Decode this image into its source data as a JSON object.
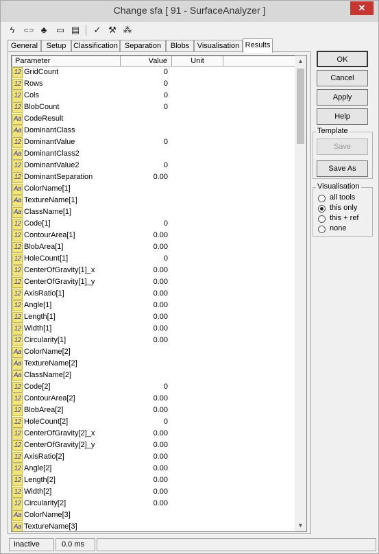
{
  "window": {
    "title": "Change sfa [ 91 - SurfaceAnalyzer ]",
    "close_glyph": "✕"
  },
  "toolbar": [
    {
      "icon": "lightning-icon",
      "glyph": "ϟ"
    },
    {
      "icon": "link-icon",
      "glyph": "⊂⊃"
    },
    {
      "icon": "tree-icon",
      "glyph": "♣"
    },
    {
      "icon": "console-icon",
      "glyph": "▭"
    },
    {
      "icon": "document-icon",
      "glyph": "▤"
    },
    {
      "icon": "check-icon",
      "glyph": "✓"
    },
    {
      "icon": "wrench-icon",
      "glyph": "⚒"
    },
    {
      "icon": "tree-structure-icon",
      "glyph": "⁂"
    }
  ],
  "tabs": [
    "General",
    "Setup",
    "Classification",
    "Separation",
    "Blobs",
    "Visualisation",
    "Results"
  ],
  "active_tab": "Results",
  "table": {
    "headers": [
      "Parameter",
      "Value",
      "Unit"
    ],
    "rows": [
      {
        "type": "12",
        "name": "GridCount",
        "value": "0"
      },
      {
        "type": "12",
        "name": "Rows",
        "value": "0"
      },
      {
        "type": "12",
        "name": "Cols",
        "value": "0"
      },
      {
        "type": "12",
        "name": "BlobCount",
        "value": "0"
      },
      {
        "type": "Aa",
        "name": "CodeResult",
        "value": ""
      },
      {
        "type": "Aa",
        "name": "DominantClass",
        "value": ""
      },
      {
        "type": "12",
        "name": "DominantValue",
        "value": "0"
      },
      {
        "type": "Aa",
        "name": "DominantClass2",
        "value": ""
      },
      {
        "type": "12",
        "name": "DominantValue2",
        "value": "0"
      },
      {
        "type": "12",
        "name": "DominantSeparation",
        "value": "0.00"
      },
      {
        "type": "Aa",
        "name": "ColorName[1]",
        "value": ""
      },
      {
        "type": "Aa",
        "name": "TextureName[1]",
        "value": ""
      },
      {
        "type": "Aa",
        "name": "ClassName[1]",
        "value": ""
      },
      {
        "type": "12",
        "name": "Code[1]",
        "value": "0"
      },
      {
        "type": "12",
        "name": "ContourArea[1]",
        "value": "0.00"
      },
      {
        "type": "12",
        "name": "BlobArea[1]",
        "value": "0.00"
      },
      {
        "type": "12",
        "name": "HoleCount[1]",
        "value": "0"
      },
      {
        "type": "12",
        "name": "CenterOfGravity[1]_x",
        "value": "0.00"
      },
      {
        "type": "12",
        "name": "CenterOfGravity[1]_y",
        "value": "0.00"
      },
      {
        "type": "12",
        "name": "AxisRatio[1]",
        "value": "0.00"
      },
      {
        "type": "12",
        "name": "Angle[1]",
        "value": "0.00"
      },
      {
        "type": "12",
        "name": "Length[1]",
        "value": "0.00"
      },
      {
        "type": "12",
        "name": "Width[1]",
        "value": "0.00"
      },
      {
        "type": "12",
        "name": "Circularity[1]",
        "value": "0.00"
      },
      {
        "type": "Aa",
        "name": "ColorName[2]",
        "value": ""
      },
      {
        "type": "Aa",
        "name": "TextureName[2]",
        "value": ""
      },
      {
        "type": "Aa",
        "name": "ClassName[2]",
        "value": ""
      },
      {
        "type": "12",
        "name": "Code[2]",
        "value": "0"
      },
      {
        "type": "12",
        "name": "ContourArea[2]",
        "value": "0.00"
      },
      {
        "type": "12",
        "name": "BlobArea[2]",
        "value": "0.00"
      },
      {
        "type": "12",
        "name": "HoleCount[2]",
        "value": "0"
      },
      {
        "type": "12",
        "name": "CenterOfGravity[2]_x",
        "value": "0.00"
      },
      {
        "type": "12",
        "name": "CenterOfGravity[2]_y",
        "value": "0.00"
      },
      {
        "type": "12",
        "name": "AxisRatio[2]",
        "value": "0.00"
      },
      {
        "type": "12",
        "name": "Angle[2]",
        "value": "0.00"
      },
      {
        "type": "12",
        "name": "Length[2]",
        "value": "0.00"
      },
      {
        "type": "12",
        "name": "Width[2]",
        "value": "0.00"
      },
      {
        "type": "12",
        "name": "Circularity[2]",
        "value": "0.00"
      },
      {
        "type": "Aa",
        "name": "ColorName[3]",
        "value": ""
      },
      {
        "type": "Aa",
        "name": "TextureName[3]",
        "value": ""
      }
    ]
  },
  "buttons": {
    "ok": "OK",
    "cancel": "Cancel",
    "apply": "Apply",
    "help": "Help"
  },
  "template": {
    "title": "Template",
    "save": "Save",
    "save_as": "Save As"
  },
  "visualisation": {
    "title": "Visualisation",
    "options": [
      "all tools",
      "this only",
      "this + ref",
      "none"
    ],
    "selected": "this only"
  },
  "statusbar": {
    "state": "Inactive",
    "time": "0.0 ms"
  },
  "scrollbar": {
    "up_glyph": "▲",
    "down_glyph": "▼"
  }
}
